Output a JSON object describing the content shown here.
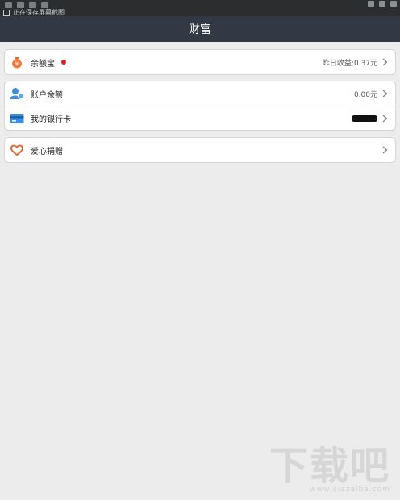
{
  "status_bar": {
    "notification_text": "正在保存屏幕截图"
  },
  "nav": {
    "title": "财富"
  },
  "groups": {
    "yuebao": {
      "label": "余额宝",
      "value": "昨日收益:0.37元"
    },
    "account": {
      "balance_label": "账户余额",
      "balance_value": "0.00元",
      "bank_label": "我的银行卡"
    },
    "donate": {
      "label": "爱心捐赠"
    }
  },
  "watermark": {
    "text": "下载吧",
    "url": "www.xiazaiba.com"
  }
}
